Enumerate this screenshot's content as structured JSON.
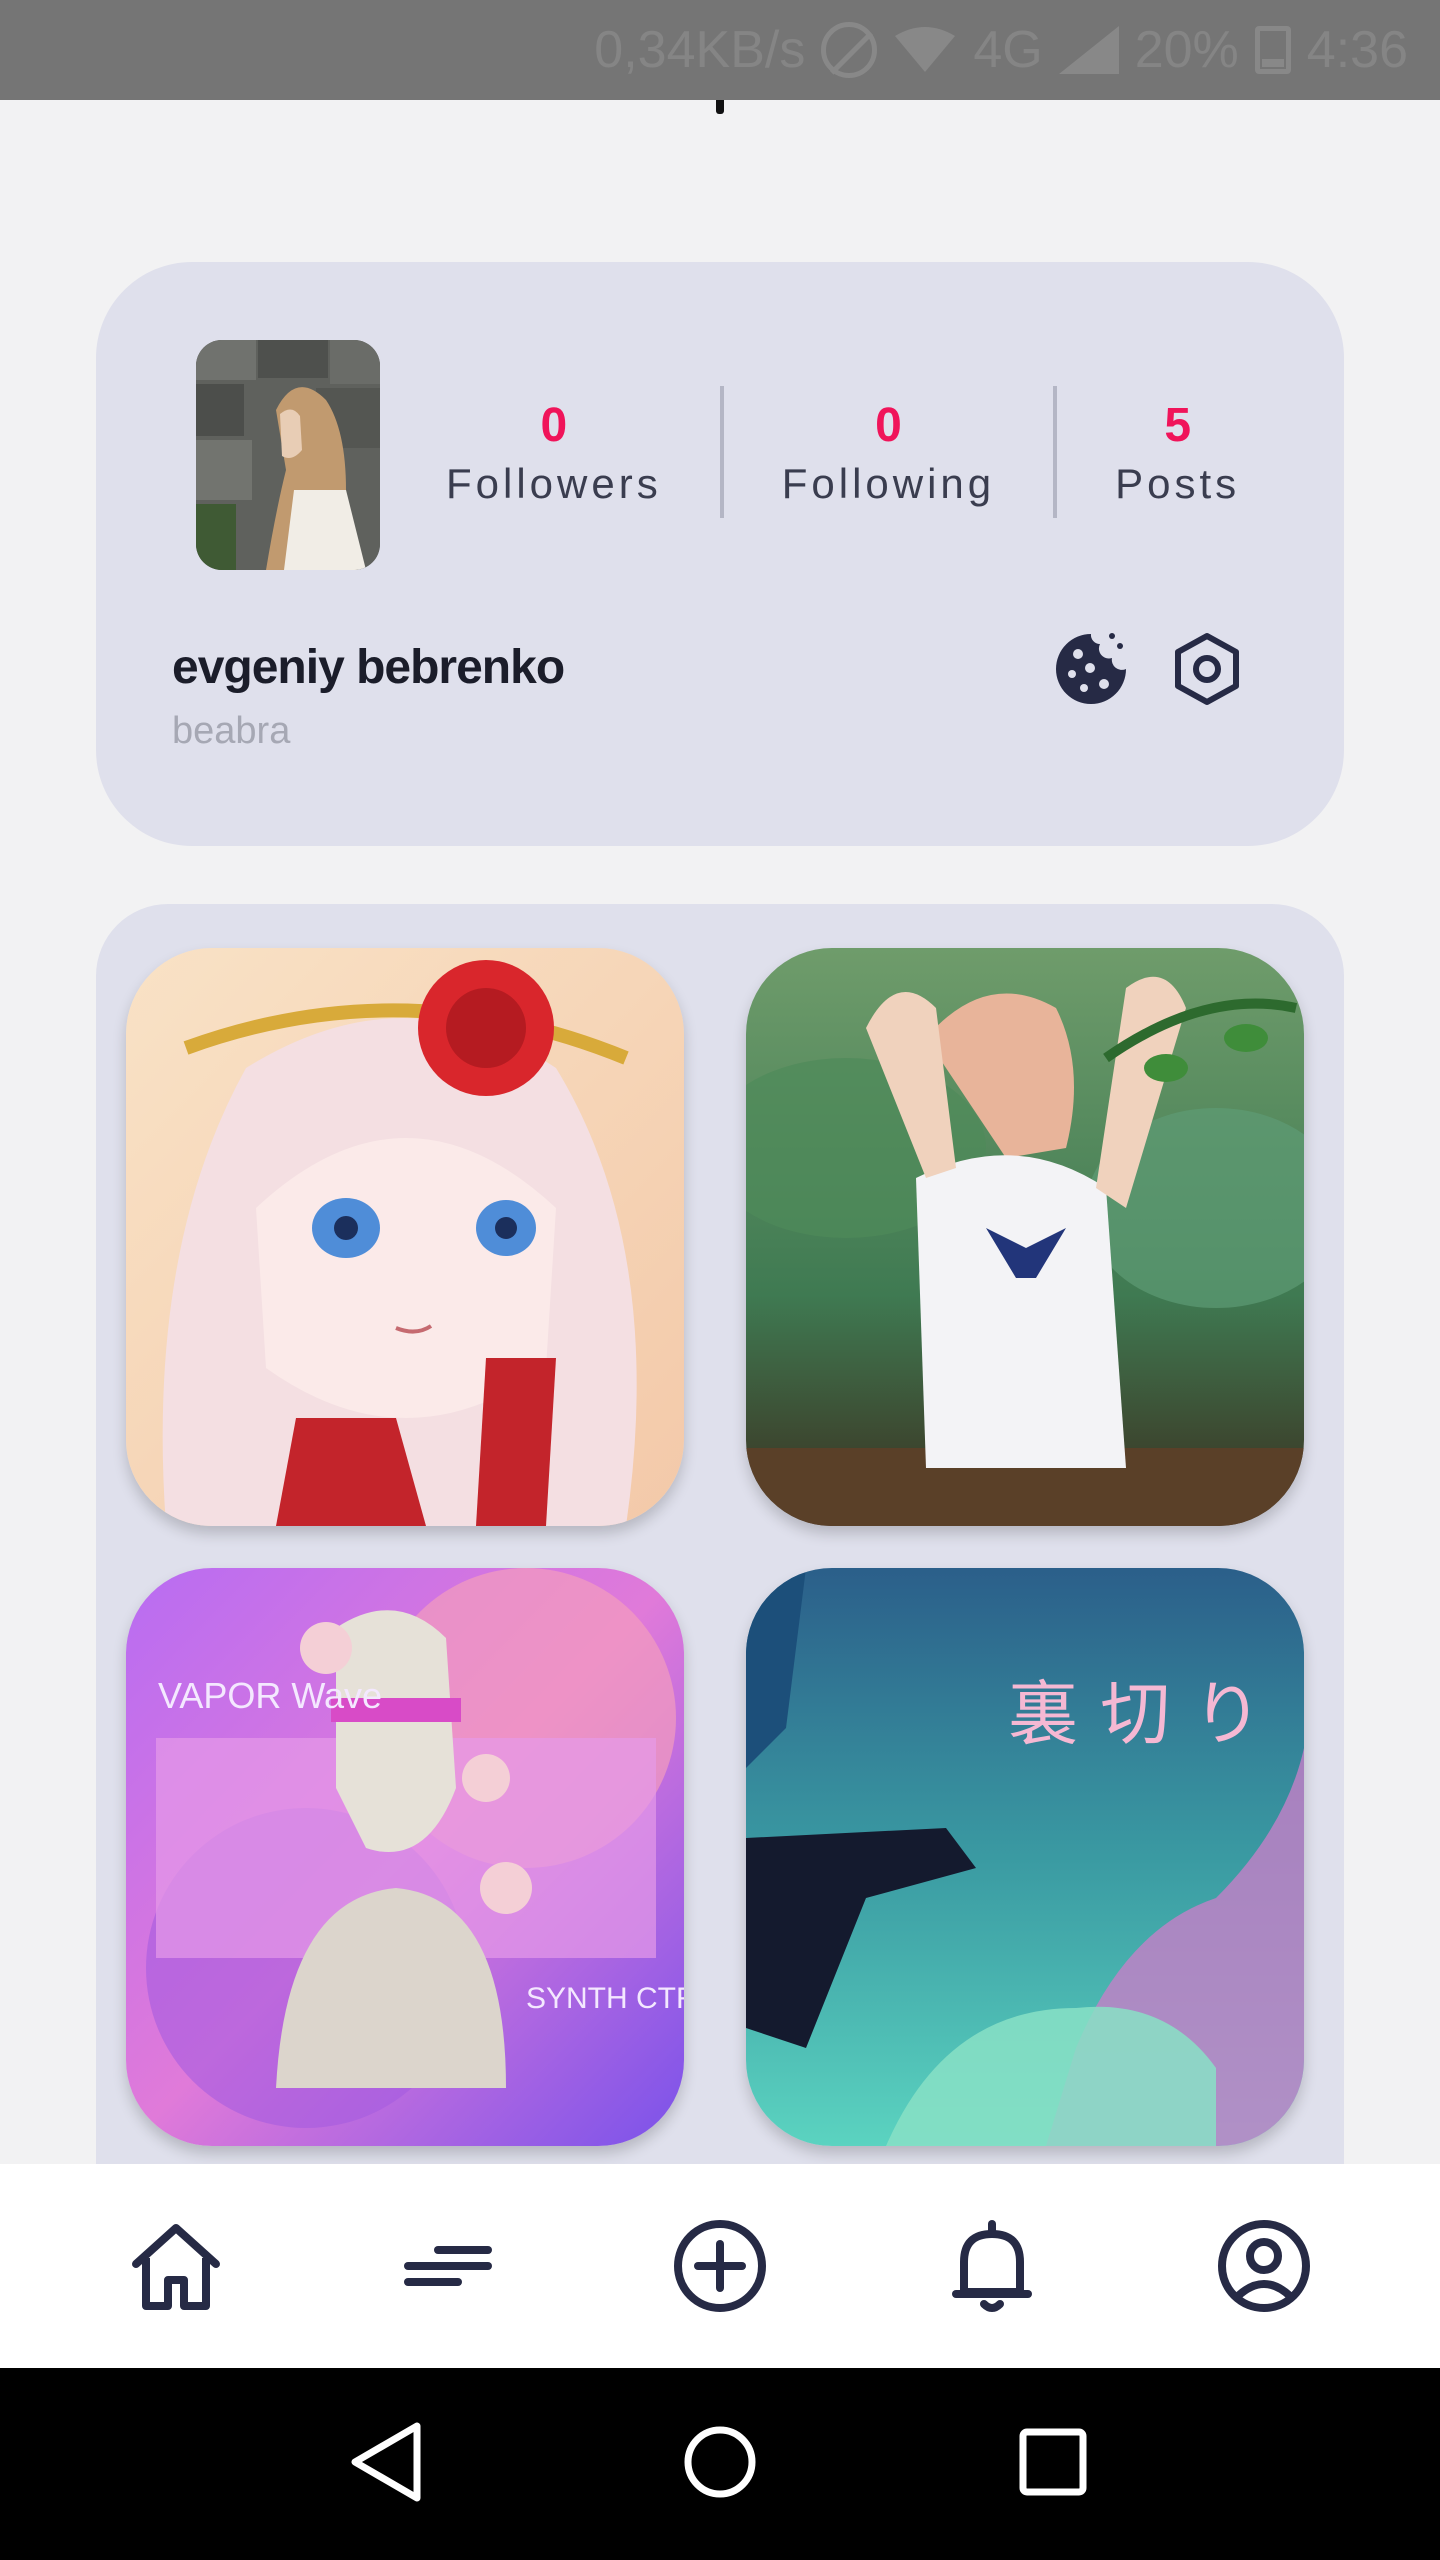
{
  "status_bar": {
    "speed": "0,34KB/s",
    "network": "4G",
    "battery": "20%",
    "time": "4:36"
  },
  "profile": {
    "name": "evgeniy bebrenko",
    "handle": "beabra",
    "stats": [
      {
        "value": "0",
        "label": "Followers"
      },
      {
        "value": "0",
        "label": "Following"
      },
      {
        "value": "5",
        "label": "Posts"
      }
    ],
    "accent_color": "#f0145a"
  },
  "gallery": {
    "posts": [
      {
        "image": "anime-girl-rose-crown"
      },
      {
        "image": "anime-girl-white-shirt"
      },
      {
        "image": "vaporwave-statue",
        "text_top": "VAPOR Wave",
        "text_bottom": "SYNTH CTRL"
      },
      {
        "image": "glitch-clouds",
        "text": "裏 切 り"
      }
    ]
  },
  "bottom_nav": {
    "items": [
      "home-icon",
      "feed-icon",
      "add-post-icon",
      "notifications-icon",
      "profile-icon"
    ]
  },
  "system_nav": {
    "items": [
      "back-icon",
      "home-circle-icon",
      "recents-icon"
    ]
  }
}
